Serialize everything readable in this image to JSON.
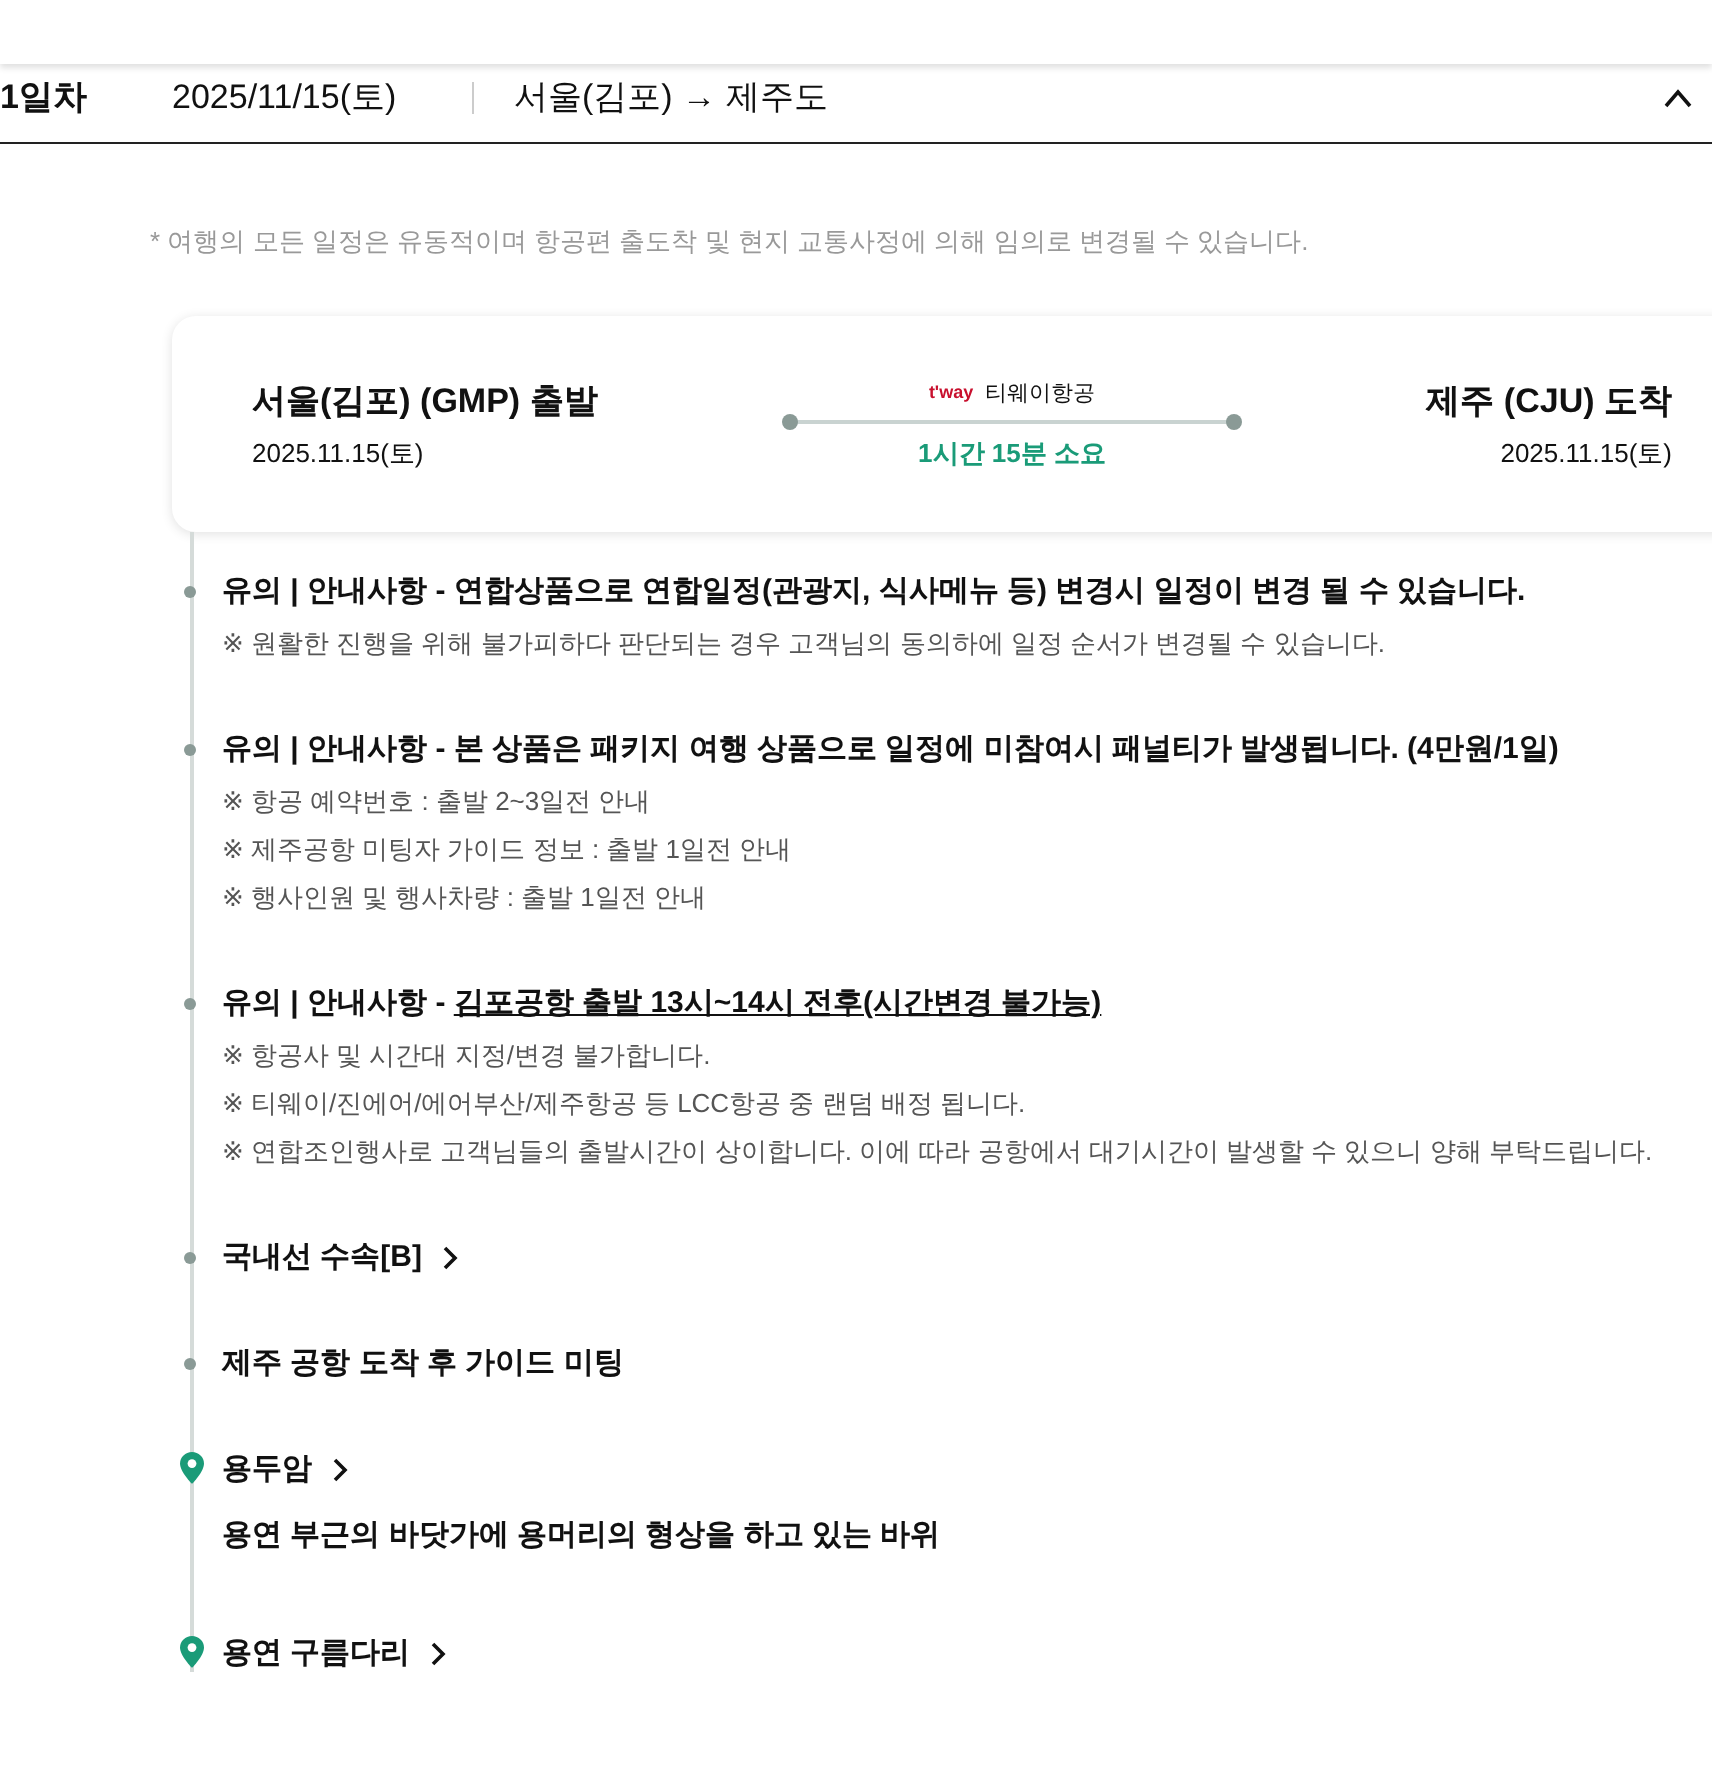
{
  "day_header": {
    "day": "1일차",
    "date": "2025/11/15(토)",
    "route": "서울(김포) → 제주도",
    "expanded": true
  },
  "notice": "* 여행의 모든 일정은 유동적이며 항공편 출도착 및 현지 교통사정에 의해 임의로 변경될 수 있습니다.",
  "flight": {
    "departure": "서울(김포) (GMP) 출발",
    "departure_date": "2025.11.15(토)",
    "airline_logo": "t'way",
    "airline": "티웨이항공",
    "duration": "1시간 15분 소요",
    "arrival": "제주 (CJU) 도착",
    "arrival_date": "2025.11.15(토)"
  },
  "timeline": [
    {
      "kind": "notice",
      "prefix": "유의 | 안내사항 - ",
      "headline": "연합상품으로 연합일정(관광지, 식사메뉴 등) 변경시 일정이 변경 될 수 있습니다.",
      "underlined": false,
      "notes": [
        "※ 원활한 진행을 위해 불가피하다 판단되는 경우 고객님의 동의하에 일정 순서가 변경될 수 있습니다."
      ]
    },
    {
      "kind": "notice",
      "prefix": "유의 | 안내사항 - ",
      "headline": "본 상품은 패키지 여행 상품으로 일정에 미참여시 패널티가 발생됩니다. (4만원/1일)",
      "underlined": false,
      "notes": [
        "※ 항공 예약번호 : 출발 2~3일전 안내",
        "※ 제주공항 미팅자 가이드 정보 : 출발 1일전 안내",
        "※ 행사인원 및 행사차량 : 출발 1일전 안내"
      ]
    },
    {
      "kind": "notice",
      "prefix": "유의 | 안내사항 - ",
      "headline": "김포공항 출발 13시~14시 전후(시간변경 불가능)",
      "underlined": true,
      "notes": [
        "※ 항공사 및 시간대 지정/변경 불가합니다.",
        "※ 티웨이/진에어/에어부산/제주항공 등 LCC항공 중 랜덤 배정 됩니다.",
        "※ 연합조인행사로 고객님들의 출발시간이 상이합니다. 이에 따라 공항에서 대기시간이 발생할 수 있으니 양해 부탁드립니다."
      ]
    },
    {
      "kind": "link",
      "title": "국내선 수속[B]"
    },
    {
      "kind": "step",
      "title": "제주 공항 도착 후 가이드 미팅"
    },
    {
      "kind": "place",
      "title": "용두암",
      "description": "용연 부근의 바닷가에 용머리의 형상을 하고 있는 바위"
    },
    {
      "kind": "place",
      "title": "용연 구름다리"
    }
  ]
}
